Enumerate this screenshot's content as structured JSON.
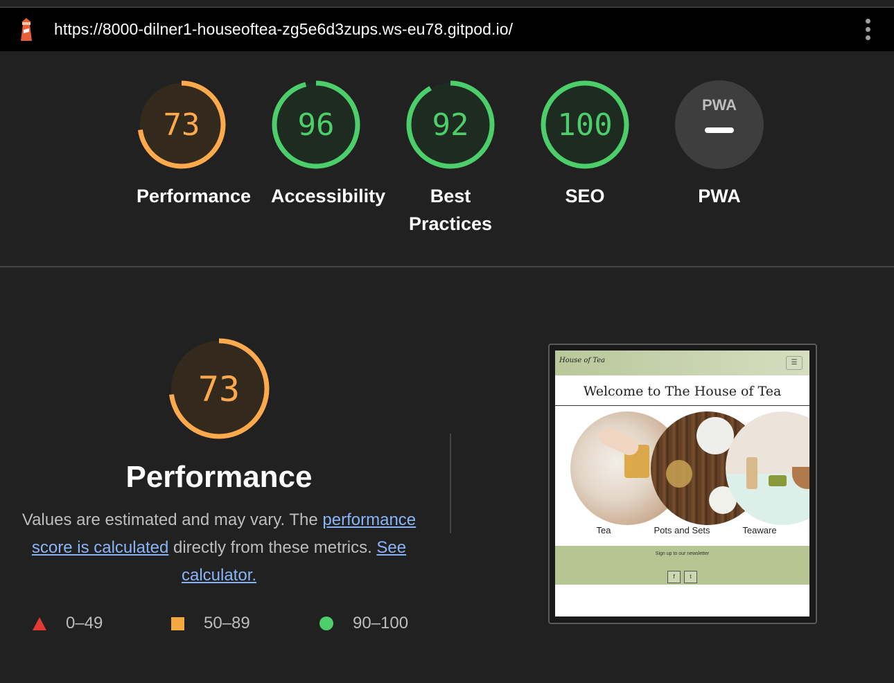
{
  "browser": {
    "url": "https://8000-dilner1-houseoftea-zg5e6d3zups.ws-eu78.gitpod.io/",
    "favicon": "lighthouse-icon",
    "menu_icon": "kebab-menu-icon"
  },
  "scores": [
    {
      "value": "73",
      "label": "Performance",
      "fraction": 0.73,
      "color": "#ffa94d"
    },
    {
      "value": "96",
      "label": "Accessibility",
      "fraction": 0.96,
      "color": "#4cce6a"
    },
    {
      "value": "92",
      "label_line1": "Best",
      "label_line2": "Practices",
      "fraction": 0.92,
      "color": "#4cce6a"
    },
    {
      "value": "100",
      "label": "SEO",
      "fraction": 1.0,
      "color": "#4cce6a"
    },
    {
      "badge": "PWA",
      "label": "PWA",
      "color": "#9e9e9e"
    }
  ],
  "performance": {
    "score": "73",
    "fraction": 0.73,
    "title": "Performance",
    "desc_before": "Values are estimated and may vary. The ",
    "link_calc": "performance score is calculated",
    "desc_middle": " directly from these metrics. ",
    "link_see": "See calculator."
  },
  "legend": [
    {
      "icon": "red-triangle-icon",
      "range": "0–49",
      "color": "#e53935"
    },
    {
      "icon": "orange-square-icon",
      "range": "50–89",
      "color": "#f4a940"
    },
    {
      "icon": "green-circle-icon",
      "range": "90–100",
      "color": "#4cce6a"
    }
  ],
  "screenshot": {
    "logo_text": "House of Tea",
    "menu_glyph": "☰",
    "heading": "Welcome to The House of Tea",
    "categories": [
      "Tea",
      "Pots and Sets",
      "Teaware"
    ],
    "newsletter": "Sign up to our newsletter",
    "social": [
      "f",
      "t"
    ]
  }
}
